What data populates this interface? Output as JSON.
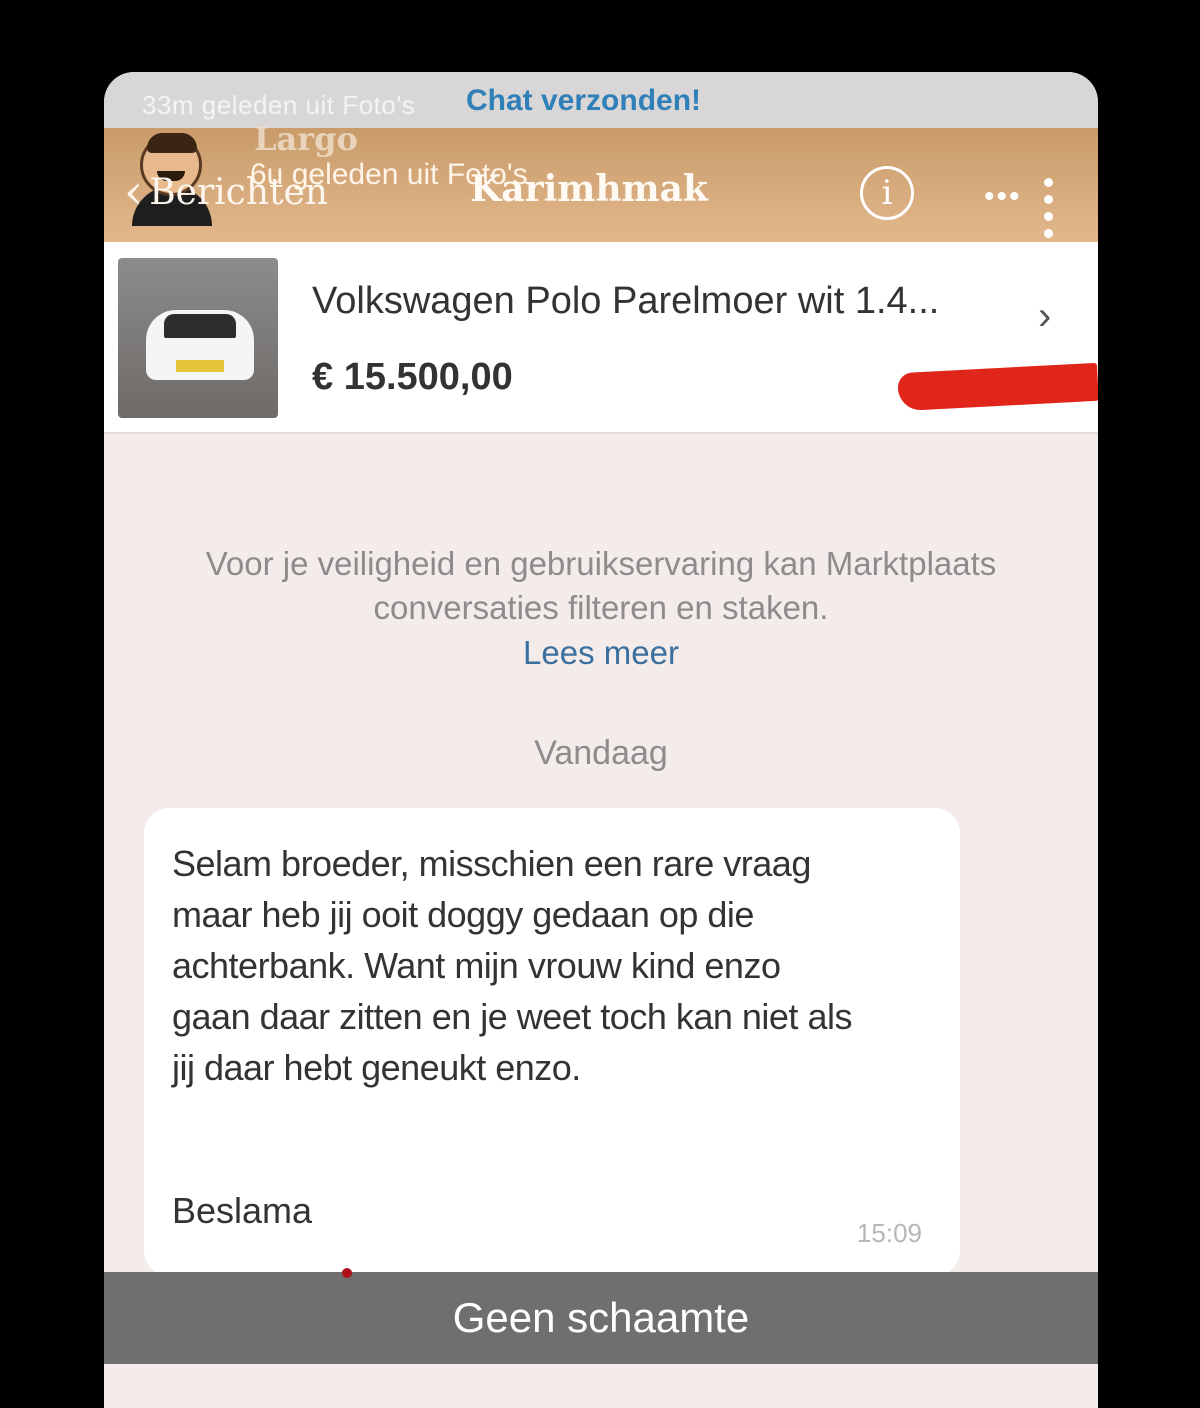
{
  "story": {
    "time_text": "33m geleden uit Foto's",
    "sent_text": "Chat verzonden!"
  },
  "header": {
    "ghost_name": "Largo",
    "ghost_sub": "6u geleden uit Foto's",
    "back_label": "Berichten",
    "title": "Karimhmak",
    "info_icon": "i",
    "more_icon": "•••"
  },
  "product": {
    "title": "Volkswagen Polo Parelmoer wit 1.4...",
    "price": "€ 15.500,00",
    "chevron": "›"
  },
  "notice": {
    "text_line1": "Voor je veiligheid en gebruikservaring kan Marktplaats",
    "text_line2": "conversaties filteren en staken.",
    "link": "Lees meer"
  },
  "day_separator": "Vandaag",
  "message": {
    "lines": [
      "Selam broeder, misschien een rare vraag",
      "maar heb jij ooit doggy gedaan op die",
      "achterbank. Want mijn vrouw kind enzo",
      "gaan daar zitten en je weet toch kan niet als",
      "jij daar hebt geneukt enzo."
    ],
    "sign_off": "Beslama",
    "time": "15:09"
  },
  "caption": "Geen schaamte",
  "colors": {
    "header_brand": "#d9ad7e",
    "sent_text": "#2f7fb8",
    "link": "#3b6f9e",
    "redaction": "#e0261b",
    "caption_bg": "#6f6f6f"
  }
}
